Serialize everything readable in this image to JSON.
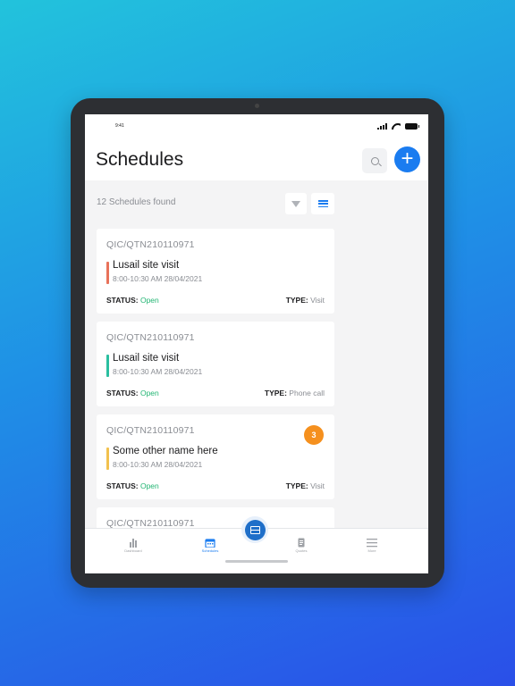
{
  "statusbar": {
    "time": "9:41"
  },
  "header": {
    "title": "Schedules"
  },
  "toolbar": {
    "count_text": "12 Schedules found"
  },
  "cards": [
    {
      "ref": "QIC/QTN210110971",
      "name": "Lusail site visit",
      "time": "8:00-10:30 AM   28/04/2021",
      "status_label": "STATUS:",
      "status": "Open",
      "type_label": "TYPE:",
      "type": "Visit",
      "bar_color": "#e8725a"
    },
    {
      "ref": "QIC/QTN210110971",
      "name": "Lusail site visit",
      "time": "8:00-10:30 AM   28/04/2021",
      "status_label": "STATUS:",
      "status": "Open",
      "type_label": "TYPE:",
      "type": "Phone call",
      "bar_color": "#2bbfa0"
    },
    {
      "ref": "QIC/QTN210110971",
      "name": "Some other name here",
      "time": "8:00-10:30 AM   28/04/2021",
      "status_label": "STATUS:",
      "status": "Open",
      "type_label": "TYPE:",
      "type": "Visit",
      "bar_color": "#f2c14e",
      "badge": "3"
    },
    {
      "ref": "QIC/QTN210110971"
    }
  ],
  "tabs": [
    {
      "label": "Dashboard",
      "icon": "bar-chart-icon"
    },
    {
      "label": "Schedules",
      "icon": "calendar-icon"
    },
    {
      "label": "Quotes",
      "icon": "document-icon"
    },
    {
      "label": "More",
      "icon": "menu-icon"
    }
  ],
  "colors": {
    "accent": "#1a7cf0",
    "status_open": "#22b573",
    "badge": "#f5901e"
  }
}
